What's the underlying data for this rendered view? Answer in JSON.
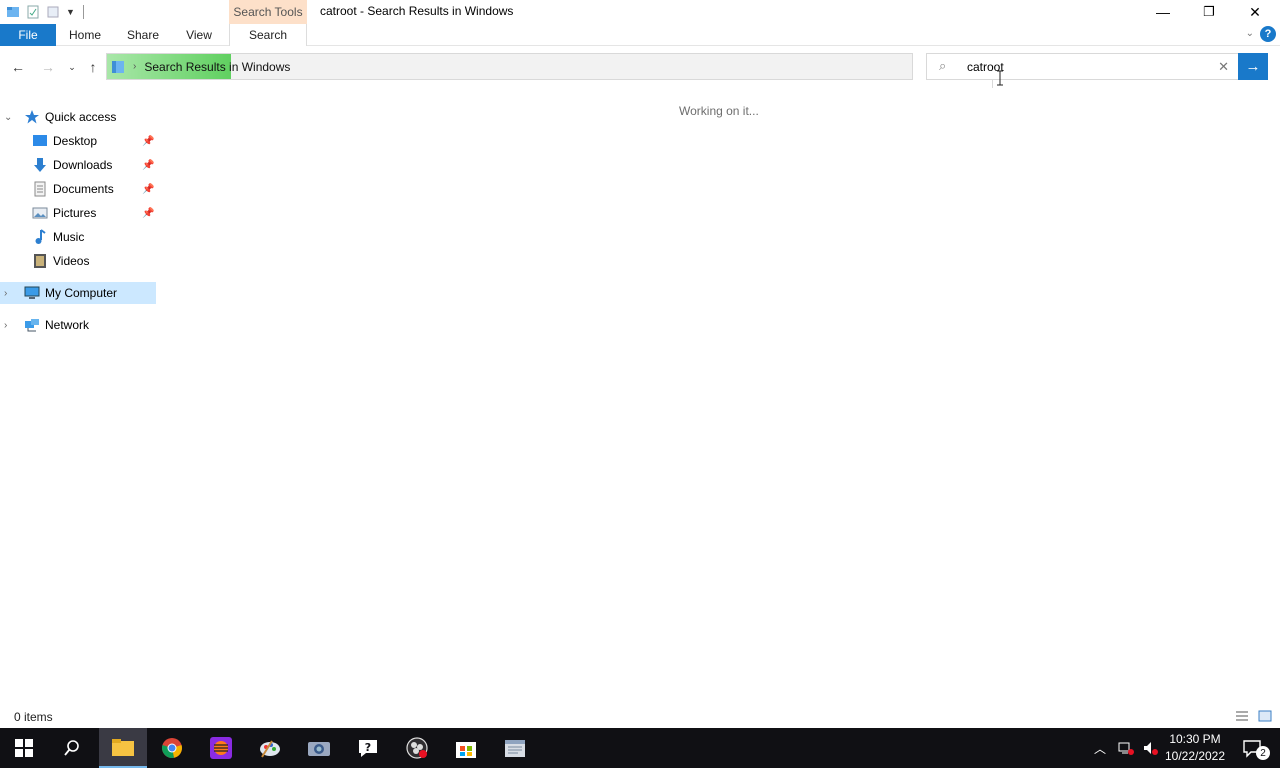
{
  "window": {
    "title": "catroot - Search Results in Windows",
    "context_tab_group": "Search Tools",
    "controls": {
      "minimize": "—",
      "restore": "❐",
      "close": "✕"
    }
  },
  "ribbon": {
    "tabs": [
      {
        "label": "File",
        "active_style": "file"
      },
      {
        "label": "Home"
      },
      {
        "label": "Share"
      },
      {
        "label": "View"
      },
      {
        "label": "Search"
      }
    ],
    "help": "?"
  },
  "address_bar": {
    "breadcrumb": [
      "Search Results in Windows"
    ],
    "progress_color": "#5fd35f"
  },
  "search_box": {
    "value": "catroot"
  },
  "nav_pane": {
    "quick_access": "Quick access",
    "items": [
      {
        "label": "Desktop",
        "icon": "desktop-icon",
        "pinned": true
      },
      {
        "label": "Downloads",
        "icon": "downloads-icon",
        "pinned": true
      },
      {
        "label": "Documents",
        "icon": "documents-icon",
        "pinned": true
      },
      {
        "label": "Pictures",
        "icon": "pictures-icon",
        "pinned": true
      },
      {
        "label": "Music",
        "icon": "music-icon",
        "pinned": false
      },
      {
        "label": "Videos",
        "icon": "videos-icon",
        "pinned": false
      }
    ],
    "my_computer": "My Computer",
    "network": "Network"
  },
  "content": {
    "message": "Working on it..."
  },
  "status_bar": {
    "item_count": "0 items"
  },
  "taskbar": {
    "apps": [
      "start-icon",
      "search-icon",
      "file-explorer-icon",
      "chrome-icon",
      "app-icon",
      "paint-icon",
      "camera-icon",
      "help-app-icon",
      "obs-icon",
      "store-icon",
      "app2-icon"
    ],
    "clock_time": "10:30 PM",
    "clock_date": "10/22/2022",
    "notification_count": "2"
  },
  "colors": {
    "accent": "#1979ca",
    "selected": "#cce8ff",
    "context_tab": "#fde0c9",
    "taskbar": "#101014"
  }
}
